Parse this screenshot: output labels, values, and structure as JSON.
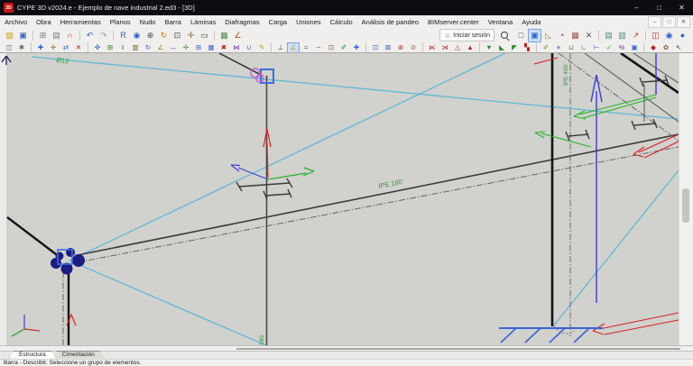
{
  "window": {
    "title": "CYPE 3D v2024.e - Ejemplo de nave industrial 2.ed3 - [3D]",
    "logo": "3D",
    "controls": [
      {
        "name": "minimize",
        "glyph": "–"
      },
      {
        "name": "maximize",
        "glyph": "□"
      },
      {
        "name": "close",
        "glyph": "✕"
      }
    ]
  },
  "menu": {
    "items": [
      "Archivo",
      "Obra",
      "Herramientas",
      "Planos",
      "Nudo",
      "Barra",
      "Láminas",
      "Diafragmas",
      "Carga",
      "Uniones",
      "Cálculo",
      "Análisis de pandeo",
      "BIMserver.center",
      "Ventana",
      "Ayuda"
    ],
    "mdi_controls": [
      {
        "name": "mdi-minimize",
        "glyph": "–"
      },
      {
        "name": "mdi-restore",
        "glyph": "□"
      },
      {
        "name": "mdi-close",
        "glyph": "✕"
      }
    ]
  },
  "toolbar1": {
    "left": [
      [
        {
          "n": "open-project",
          "g": "▨",
          "c": "#d09a18"
        },
        {
          "n": "save",
          "g": "▣",
          "c": "#3a62b8"
        }
      ],
      [
        {
          "n": "print-preview",
          "g": "⊞",
          "c": "#777"
        },
        {
          "n": "print-drawing",
          "g": "▤",
          "c": "#777"
        },
        {
          "n": "snap-magnet",
          "g": "∩",
          "c": "#c42020"
        }
      ],
      [
        {
          "n": "undo",
          "g": "↶",
          "c": "#2a62c8"
        },
        {
          "n": "redo",
          "g": "↷",
          "c": "#999"
        }
      ],
      [
        {
          "n": "redraw",
          "g": "R",
          "c": "#2a62c8"
        },
        {
          "n": "zoom-extents",
          "g": "◉",
          "c": "#2a62c8"
        },
        {
          "n": "zoom-in",
          "g": "⊕",
          "c": "#444"
        },
        {
          "n": "refresh-view",
          "g": "↻",
          "c": "#e07818"
        },
        {
          "n": "zoom-window",
          "g": "⊡",
          "c": "#444"
        },
        {
          "n": "pan",
          "g": "✛",
          "c": "#8a6a2a"
        },
        {
          "n": "full-screen",
          "g": "▭",
          "c": "#444"
        }
      ],
      [
        {
          "n": "capture-image",
          "g": "▦",
          "c": "#4a8a4a"
        },
        {
          "n": "measure-angle",
          "g": "∠",
          "c": "#b05010"
        }
      ]
    ],
    "login_label": "Iniciar sesión",
    "right": [
      [
        {
          "n": "view-frame",
          "g": "□",
          "c": "#444"
        },
        {
          "n": "view-render",
          "g": "▣",
          "c": "#2a62c8",
          "sel": true
        },
        {
          "n": "view-ruler",
          "g": "◺",
          "c": "#b08030"
        },
        {
          "n": "view-clock",
          "g": "◔",
          "c": "#444"
        },
        {
          "n": "view-table",
          "g": "▦",
          "c": "#a05050"
        },
        {
          "n": "view-tools",
          "g": "✕",
          "c": "#555"
        }
      ],
      [
        {
          "n": "print-report",
          "g": "▤",
          "c": "#4a8a8a"
        },
        {
          "n": "print-plans",
          "g": "▥",
          "c": "#4a8a8a"
        },
        {
          "n": "export",
          "g": "↗",
          "c": "#cc3030"
        }
      ],
      [
        {
          "n": "bim-building",
          "g": "◫",
          "c": "#b03030"
        },
        {
          "n": "web-help",
          "g": "◉",
          "c": "#2a62c8"
        },
        {
          "n": "web-cype",
          "g": "●",
          "c": "#2a62c8"
        }
      ]
    ]
  },
  "toolbar2": {
    "groups": [
      [
        {
          "n": "window-3d",
          "g": "◫",
          "c": "#666"
        },
        {
          "n": "view-options",
          "g": "✱",
          "c": "#666"
        }
      ],
      [
        {
          "n": "node-new",
          "g": "✚",
          "c": "#2a62c8"
        },
        {
          "n": "node-move",
          "g": "✛",
          "c": "#b04818"
        },
        {
          "n": "node-link",
          "g": "⇄",
          "c": "#2a62c8"
        },
        {
          "n": "node-delete",
          "g": "✕",
          "c": "#b02020"
        }
      ],
      [
        {
          "n": "bar-move",
          "g": "✜",
          "c": "#3a62c8"
        },
        {
          "n": "bar-copy",
          "g": "⊞",
          "c": "#2a8a2a"
        },
        {
          "n": "bar-describe",
          "g": "I",
          "c": "#203080"
        },
        {
          "n": "bar-material",
          "g": "▥",
          "c": "#7a5a20"
        },
        {
          "n": "bar-rotate",
          "g": "↻",
          "c": "#3a62c8"
        },
        {
          "n": "bar-angle",
          "g": "∠",
          "c": "#b07010"
        },
        {
          "n": "bar-length",
          "g": "↔",
          "c": "#3a3a3a"
        },
        {
          "n": "bar-axes",
          "g": "✢",
          "c": "#2a8a2a"
        },
        {
          "n": "bar-grid",
          "g": "⊞",
          "c": "#3a62c8"
        },
        {
          "n": "bar-table",
          "g": "▦",
          "c": "#3a62c8"
        },
        {
          "n": "bar-delete",
          "g": "✖",
          "c": "#c02020"
        },
        {
          "n": "bar-split",
          "g": "⋈",
          "c": "#7030a0"
        },
        {
          "n": "bar-join",
          "g": "∪",
          "c": "#3a62c8"
        },
        {
          "n": "bar-edit",
          "g": "✎",
          "c": "#b0a018"
        }
      ],
      [
        {
          "n": "axis-local",
          "g": "⊥",
          "c": "#3a3a3a"
        },
        {
          "n": "profile-edit",
          "g": "∠",
          "c": "#b0a018",
          "sel": true
        },
        {
          "n": "profile-copy",
          "g": "≈",
          "c": "#7030a0"
        },
        {
          "n": "axis-dashed",
          "g": "┄",
          "c": "#3a3a3a"
        },
        {
          "n": "section-view",
          "g": "⊡",
          "c": "#8a5a2a"
        },
        {
          "n": "material-paint",
          "g": "✐",
          "c": "#2a8a2a"
        },
        {
          "n": "bar-grow",
          "g": "✚",
          "c": "#3a62c8"
        }
      ],
      [
        {
          "n": "select-window",
          "g": "⊡",
          "c": "#3a62c8"
        },
        {
          "n": "select-crossing",
          "g": "⊠",
          "c": "#3a62c8"
        },
        {
          "n": "group-elements",
          "g": "⊛",
          "c": "#b02020"
        },
        {
          "n": "export-dwg",
          "g": "⊘",
          "c": "#8a6a2a"
        }
      ],
      [
        {
          "n": "flange-left",
          "g": "⋉",
          "c": "#b02020"
        },
        {
          "n": "flange-right",
          "g": "⋊",
          "c": "#b02020"
        },
        {
          "n": "stiffener",
          "g": "△",
          "c": "#b02020"
        },
        {
          "n": "weld",
          "g": "▲",
          "c": "#b02020"
        }
      ],
      [
        {
          "n": "tie-down",
          "g": "▼",
          "c": "#2a8a2a"
        },
        {
          "n": "tie-corner1",
          "g": "◣",
          "c": "#2a8a2a"
        },
        {
          "n": "tie-corner2",
          "g": "◤",
          "c": "#2a8a2a"
        },
        {
          "n": "tie-pattern",
          "g": "▚",
          "c": "#b02020"
        }
      ],
      [
        {
          "n": "paint-loads",
          "g": "✐",
          "c": "#8a8a20"
        },
        {
          "n": "load-list",
          "g": "≡",
          "c": "#3a62c8"
        },
        {
          "n": "load-folder",
          "g": "⊔",
          "c": "#8a6a2a"
        },
        {
          "n": "dim-angle",
          "g": "∟",
          "c": "#3a3a3a"
        },
        {
          "n": "dim-line",
          "g": "⊢",
          "c": "#3a62c8"
        },
        {
          "n": "check-bar",
          "g": "✓",
          "c": "#2a8a2a"
        },
        {
          "n": "usage-percent",
          "g": "%",
          "c": "#7030a0"
        },
        {
          "n": "frame-view",
          "g": "▣",
          "c": "#3a62c8"
        }
      ],
      [
        {
          "n": "report-memo",
          "g": "◆",
          "c": "#b02020"
        },
        {
          "n": "flower-mark",
          "g": "✿",
          "c": "#8a5a2a"
        },
        {
          "n": "send-back",
          "g": "↖",
          "c": "#3a3a3a"
        }
      ]
    ]
  },
  "canvas": {
    "labels": {
      "rod_diameter": "Ø12",
      "beam_profile": "IPE 180",
      "column_profile": "IPE 400",
      "base_profile": "180"
    },
    "colors": {
      "background": "#d1d1ce",
      "cyan_line": "#62b8d6",
      "label_green": "#2e9b2e",
      "structure_dark": "#3c3c3c",
      "node_navy": "#1c1c82",
      "selection_blue": "#3b6fd6",
      "load_magenta": "#c55fd0",
      "arrow_red": "#e02020",
      "arrow_green": "#28b428",
      "arrow_blue": "#4040d8",
      "support_blue": "#3b64d8"
    }
  },
  "tabs": [
    {
      "label": "Estructura",
      "active": true
    },
    {
      "label": "Cimentación",
      "active": false
    }
  ],
  "status": {
    "text": "Barra - Describir. Seleccione un grupo de elementos."
  }
}
